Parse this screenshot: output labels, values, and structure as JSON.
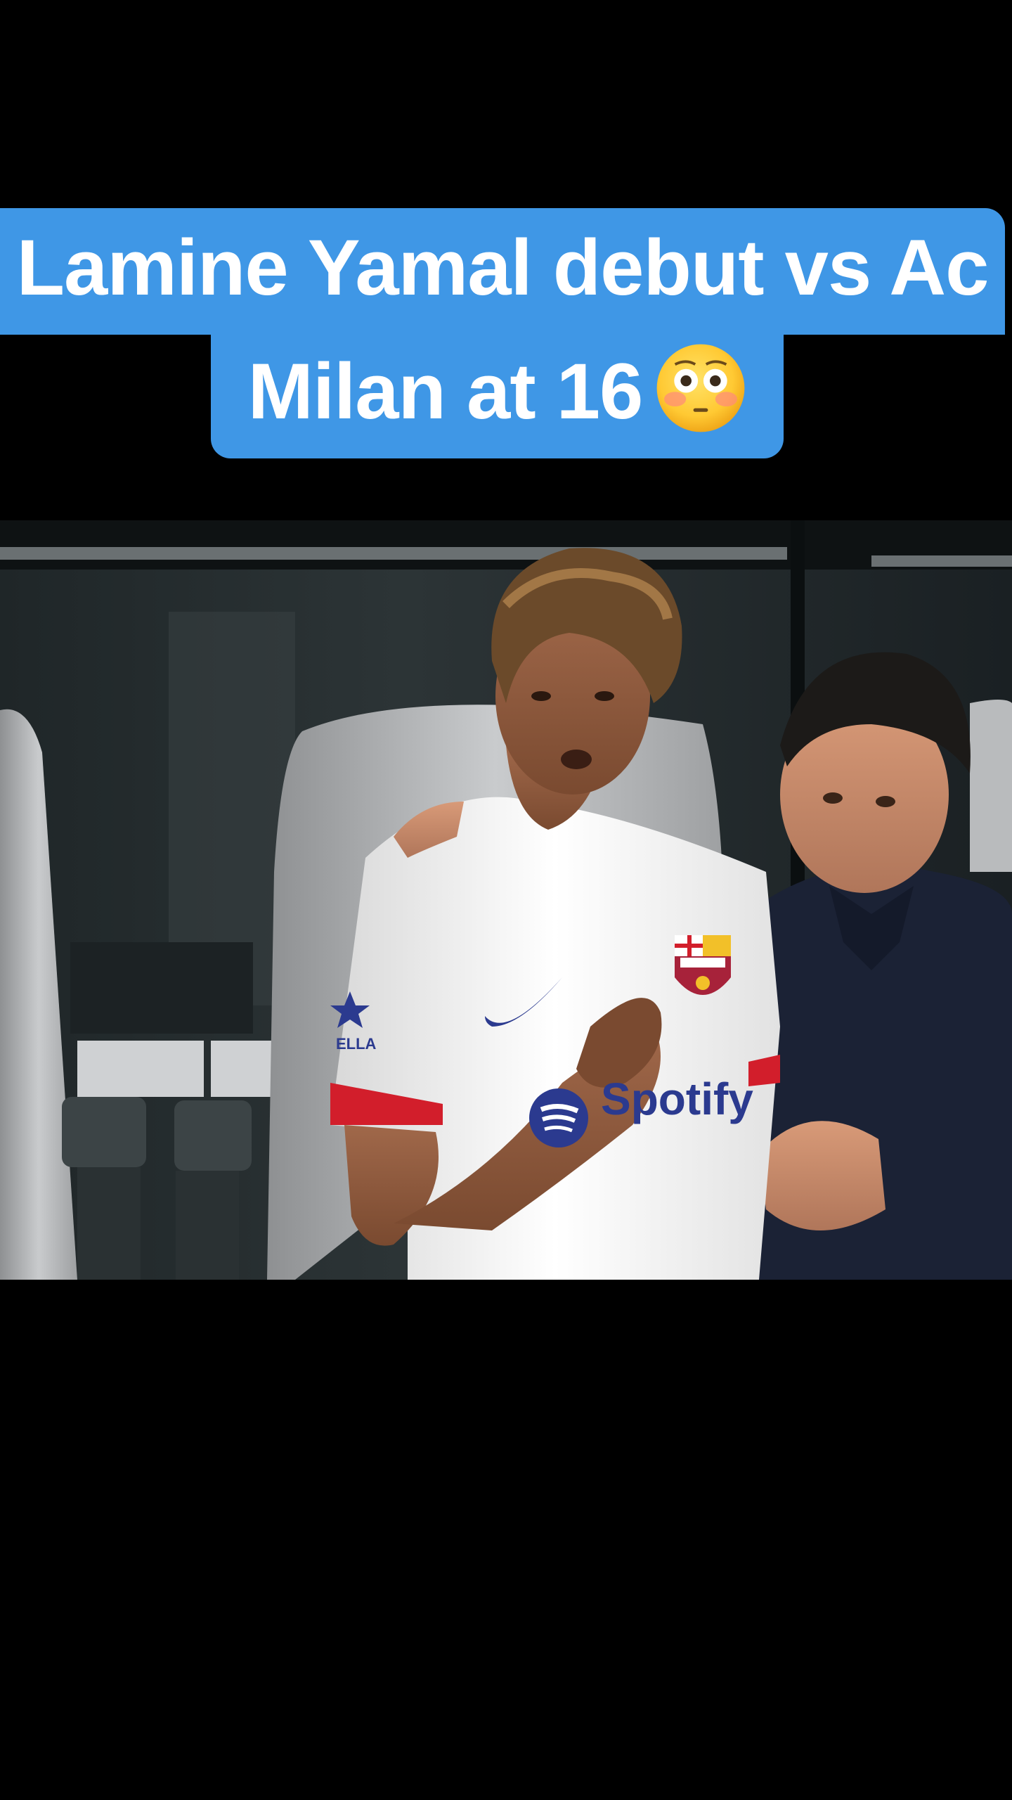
{
  "caption": {
    "line1": "Lamine Yamal debut vs Ac",
    "line2": "Milan at 16",
    "emoji": "flushed-face-emoji"
  },
  "video": {
    "jersey_sponsor": "Spotify",
    "jersey_crest": "FCB",
    "sleeve_text": "ELLA"
  },
  "colors": {
    "background": "#000000",
    "caption_bg": "#3f97e6",
    "caption_text": "#ffffff"
  }
}
